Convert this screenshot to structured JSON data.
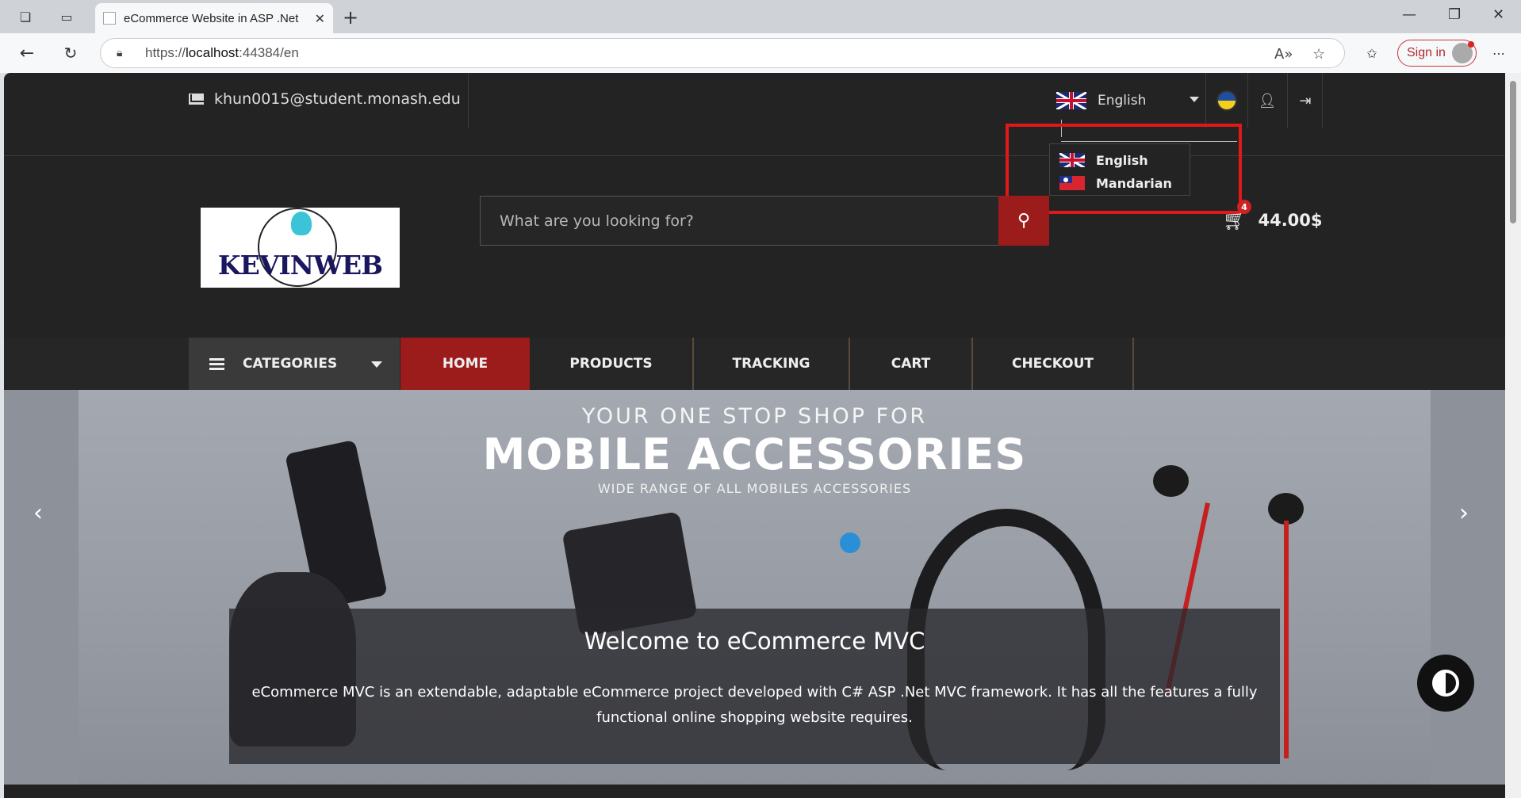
{
  "browser": {
    "tab_title": "eCommerce Website in ASP .Net",
    "url_prefix": "https://",
    "url_host": "localhost",
    "url_rest": ":44384/en",
    "sign_in_label": "Sign in"
  },
  "topbar": {
    "email": "khun0015@student.monash.edu",
    "language_selected": "English"
  },
  "language_dropdown": {
    "options": [
      {
        "label": "English",
        "flag": "uk-flag-icon"
      },
      {
        "label": "Mandarian",
        "flag": "taiwan-flag-icon"
      }
    ]
  },
  "logo": {
    "text": "KEVINWEB"
  },
  "search": {
    "placeholder": "What are you looking for?"
  },
  "cart": {
    "count": "4",
    "total": "44.00$"
  },
  "nav": {
    "categories_label": "CATEGORIES",
    "items": [
      "HOME",
      "PRODUCTS",
      "TRACKING",
      "CART",
      "CHECKOUT"
    ],
    "active": "HOME"
  },
  "hero": {
    "line1": "YOUR ONE STOP SHOP FOR",
    "line2": "MOBILE ACCESSORIES",
    "line3": "WIDE RANGE OF ALL MOBILES ACCESSORIES",
    "caption_title": "Welcome to eCommerce MVC",
    "caption_text": "eCommerce MVC is an extendable, adaptable eCommerce project developed with C# ASP .Net MVC framework. It has all the features a fully functional online shopping website requires."
  },
  "colors": {
    "accent": "#9c1c1c",
    "page_bg": "#232323",
    "highlight_box": "#e01818"
  }
}
